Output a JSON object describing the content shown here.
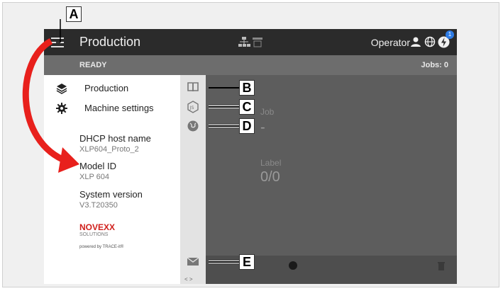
{
  "topbar": {
    "title": "Production",
    "operator": "Operator",
    "badge": "1"
  },
  "statusbar": {
    "status": "READY",
    "jobs": "Jobs: 0"
  },
  "menu": {
    "items": [
      {
        "label": "Production",
        "icon": "layers-icon"
      },
      {
        "label": "Machine settings",
        "icon": "gear-icon"
      }
    ],
    "info": [
      {
        "key": "DHCP host name",
        "value": "XLP604_Proto_2"
      },
      {
        "key": "Model ID",
        "value": "XLP 604"
      },
      {
        "key": "System version",
        "value": "V3.T20350"
      }
    ],
    "logo": "NOVEXX",
    "logo_sub": "SOLUTIONS",
    "logo_tiny": "powered by TRACE-it®"
  },
  "rail": {
    "icons": [
      "book-icon",
      "js-icon",
      "globe-icon",
      "mail-icon"
    ],
    "scroll": "< >"
  },
  "main": {
    "job_label": "Job",
    "job_value": "-",
    "label_label": "Label",
    "label_value": "0/0"
  },
  "callouts": {
    "a": "A",
    "b": "B",
    "c": "C",
    "d": "D",
    "e": "E"
  },
  "colors": {
    "arrow": "#e8201c",
    "topbar": "#2b2b2b",
    "statusbar": "#6d6d6d",
    "badge": "#2d7be5"
  }
}
